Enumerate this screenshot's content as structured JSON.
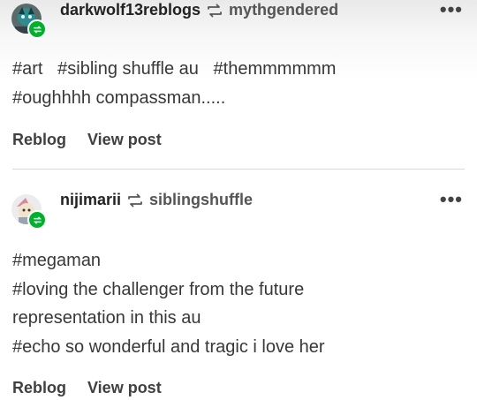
{
  "posts": [
    {
      "username": "darkwolf13reblogs",
      "reblogged_from": "mythgendered",
      "more_label": "•••",
      "tag_lines": [
        "#art   #sibling shuffle au   #themmmmmm",
        "#oughhhh compassman....."
      ],
      "actions": {
        "reblog": "Reblog",
        "view_post": "View post"
      }
    },
    {
      "username": "nijimarii",
      "reblogged_from": "siblingshuffle",
      "more_label": "•••",
      "tag_lines": [
        "#megaman",
        "#loving the challenger from the future",
        "representation in this au",
        "#echo so wonderful and tragic i love her"
      ],
      "actions": {
        "reblog": "Reblog",
        "view_post": "View post"
      }
    }
  ],
  "colors": {
    "reblog_badge": "#00b12b",
    "divider": "#d9d9d9"
  }
}
